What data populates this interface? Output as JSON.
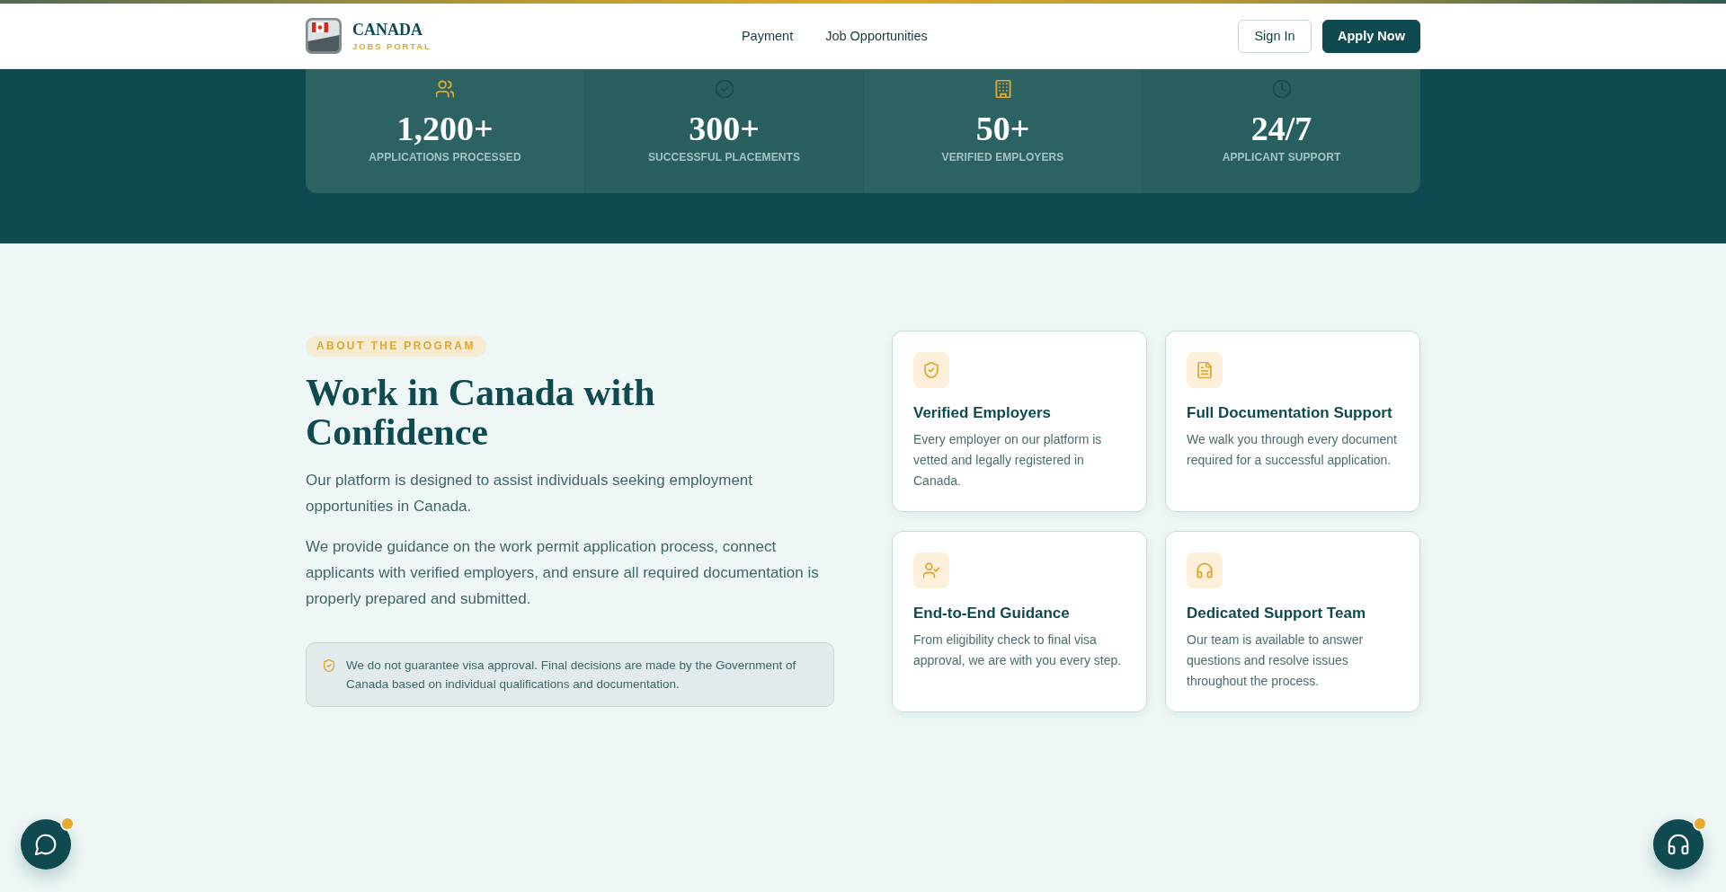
{
  "header": {
    "brand": {
      "name": "CANADA",
      "tagline": "JOBS PORTAL"
    },
    "nav": [
      "Payment",
      "Job Opportunities"
    ],
    "buttons": [
      {
        "label": "Sign In",
        "kind": "outline"
      },
      {
        "label": "Apply Now",
        "kind": "primary"
      }
    ]
  },
  "stats": [
    {
      "value": "1,200+",
      "label": "APPLICATIONS PROCESSED",
      "color": "#e0a82e"
    },
    {
      "value": "300+",
      "label": "SUCCESSFUL PLACEMENTS",
      "color": "#174d52"
    },
    {
      "value": "50+",
      "label": "VERIFIED EMPLOYERS",
      "color": "#e0a82e"
    },
    {
      "value": "24/7",
      "label": "APPLICANT SUPPORT",
      "color": "#174d52"
    }
  ],
  "about": {
    "badge": "ABOUT THE PROGRAM",
    "heading": "Work in Canada with Confidence",
    "paragraphs": [
      "Our platform is designed to assist individuals seeking employment opportunities in Canada.",
      "We provide guidance on the work permit application process, connect applicants with verified employers, and ensure all required documentation is properly prepared and submitted."
    ],
    "notice": "We do not guarantee visa approval. Final decisions are made by the Government of Canada based on individual qualifications and documentation."
  },
  "features": [
    {
      "title": "Verified Employers",
      "description": "Every employer on our platform is vetted and legally registered in Canada."
    },
    {
      "title": "Full Documentation Support",
      "description": "We walk you through every document required for a successful application."
    },
    {
      "title": "End-to-End Guidance",
      "description": "From eligibility check to final visa approval, we are with you every step."
    },
    {
      "title": "Dedicated Support Team",
      "description": "Our team is available to answer questions and resolve issues throughout the process."
    }
  ],
  "floating_buttons": [
    {
      "notification": true
    },
    {
      "notification": true
    }
  ]
}
